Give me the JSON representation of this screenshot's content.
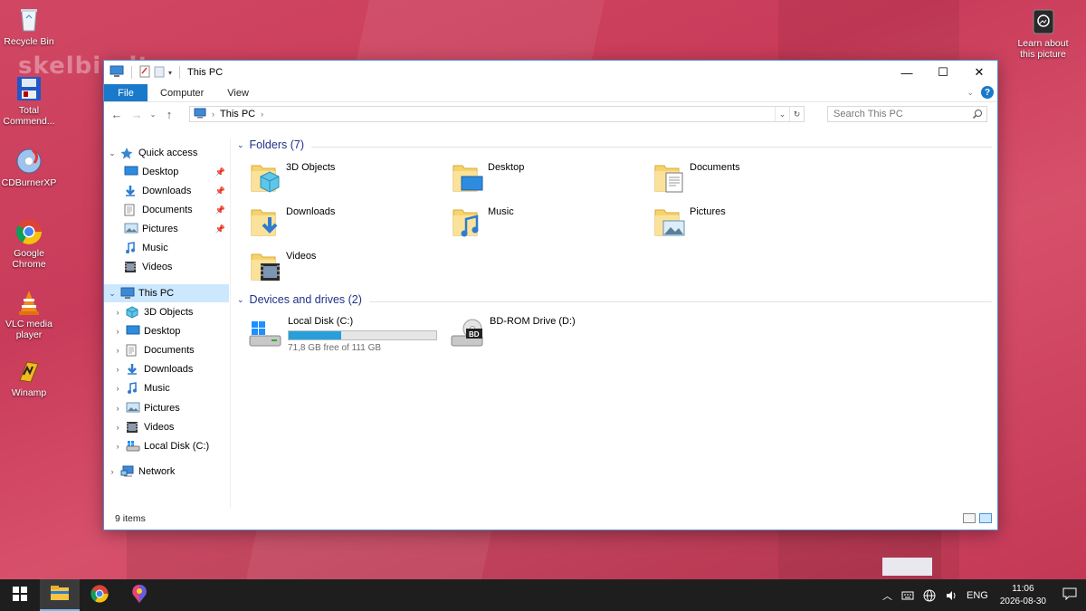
{
  "desktop": {
    "watermark": "skelbiu.lt",
    "icons": [
      {
        "label": "Recycle Bin",
        "icon": "recycle-bin-icon"
      },
      {
        "label": "Total Commend...",
        "icon": "total-commander-icon"
      },
      {
        "label": "CDBurnerXP",
        "icon": "cdburnerxp-icon"
      },
      {
        "label": "Google Chrome",
        "icon": "chrome-icon"
      },
      {
        "label": "VLC media player",
        "icon": "vlc-icon"
      },
      {
        "label": "Winamp",
        "icon": "winamp-icon"
      }
    ],
    "spotlight": {
      "label": "Learn about this picture",
      "icon": "camera-icon"
    }
  },
  "window": {
    "title": "This PC",
    "controls": {
      "minimize": "—",
      "maximize": "☐",
      "close": "✕"
    },
    "ribbon": {
      "file": "File",
      "tabs": [
        "Computer",
        "View"
      ]
    },
    "address": {
      "path": "This PC"
    },
    "search": {
      "placeholder": "Search This PC"
    },
    "sidebar": {
      "quick_access": "Quick access",
      "quick_items": [
        "Desktop",
        "Downloads",
        "Documents",
        "Pictures",
        "Music",
        "Videos"
      ],
      "this_pc": "This PC",
      "pc_items": [
        "3D Objects",
        "Desktop",
        "Documents",
        "Downloads",
        "Music",
        "Pictures",
        "Videos",
        "Local Disk (C:)"
      ],
      "network": "Network"
    },
    "folders_header": "Folders (7)",
    "folders": [
      "3D Objects",
      "Desktop",
      "Documents",
      "Downloads",
      "Music",
      "Pictures",
      "Videos"
    ],
    "drives_header": "Devices and drives (2)",
    "drives": [
      {
        "name": "Local Disk (C:)",
        "free": "71,8 GB free of 111 GB",
        "used_fraction": 0.353
      },
      {
        "name": "BD-ROM Drive (D:)",
        "badge": "BD"
      }
    ],
    "status": "9 items"
  },
  "taskbar": {
    "apps": [
      "start-icon",
      "file-explorer-icon",
      "chrome-icon",
      "paint-icon"
    ],
    "language": "ENG",
    "time": "11:06",
    "date": "2026-08-30"
  },
  "colors": {
    "accent": "#1979ca",
    "selection": "#cce8ff",
    "group_header": "#1e3287",
    "drive_bar": "#26a0da",
    "folder": "#f6d36b"
  }
}
